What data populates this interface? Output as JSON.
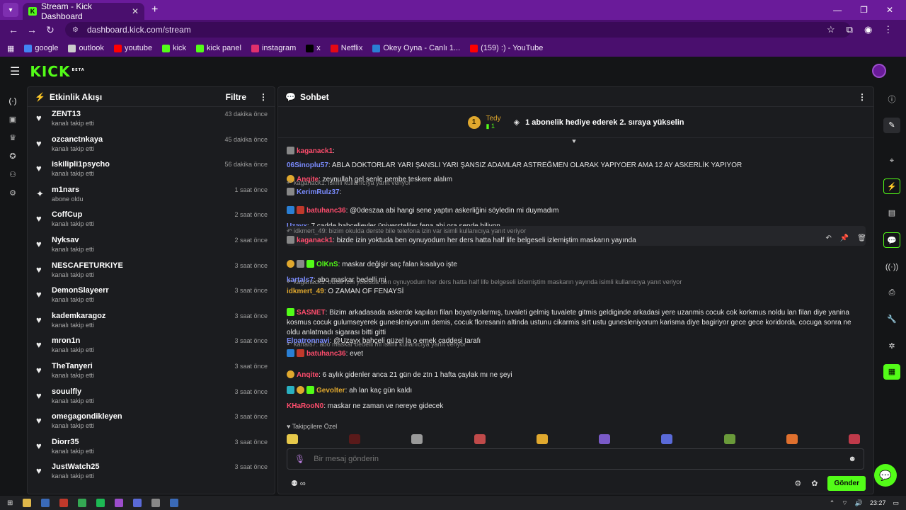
{
  "browser": {
    "tab_title": "Stream - Kick Dashboard",
    "url": "dashboard.kick.com/stream",
    "bookmarks": [
      {
        "label": "google",
        "color": "#4285f4"
      },
      {
        "label": "outlook",
        "color": "#cccccc"
      },
      {
        "label": "youtube",
        "color": "#ff0000"
      },
      {
        "label": "kick",
        "color": "#53fc18"
      },
      {
        "label": "kick panel",
        "color": "#53fc18"
      },
      {
        "label": "instagram",
        "color": "#e1306c"
      },
      {
        "label": "x",
        "color": "#000000"
      },
      {
        "label": "Netflix",
        "color": "#e50914"
      },
      {
        "label": "Okey Oyna - Canlı 1...",
        "color": "#2a7fd4"
      },
      {
        "label": "(159) :) - YouTube",
        "color": "#ff0000"
      }
    ]
  },
  "header": {
    "logo": "KICK",
    "beta": "BETA"
  },
  "activity": {
    "title": "Etkinlik Akışı",
    "filter": "Filtre",
    "items": [
      {
        "user": "ZENT13",
        "action": "kanalı takip etti",
        "time": "43 dakika önce",
        "icon": "heart-icon"
      },
      {
        "user": "ozcanctnkaya",
        "action": "kanalı takip etti",
        "time": "45 dakika önce",
        "icon": "heart-icon"
      },
      {
        "user": "iskilipli1psycho",
        "action": "kanalı takip etti",
        "time": "56 dakika önce",
        "icon": "heart-icon"
      },
      {
        "user": "m1nars",
        "action": "abone oldu",
        "time": "1 saat önce",
        "icon": "star-icon"
      },
      {
        "user": "CoffCup",
        "action": "kanalı takip etti",
        "time": "2 saat önce",
        "icon": "heart-icon"
      },
      {
        "user": "Nyksav",
        "action": "kanalı takip etti",
        "time": "2 saat önce",
        "icon": "heart-icon"
      },
      {
        "user": "NESCAFETURKIYE",
        "action": "kanalı takip etti",
        "time": "3 saat önce",
        "icon": "heart-icon"
      },
      {
        "user": "DemonSlayeerr",
        "action": "kanalı takip etti",
        "time": "3 saat önce",
        "icon": "heart-icon"
      },
      {
        "user": "kademkaragoz",
        "action": "kanalı takip etti",
        "time": "3 saat önce",
        "icon": "heart-icon"
      },
      {
        "user": "mron1n",
        "action": "kanalı takip etti",
        "time": "3 saat önce",
        "icon": "heart-icon"
      },
      {
        "user": "TheTanyeri",
        "action": "kanalı takip etti",
        "time": "3 saat önce",
        "icon": "heart-icon"
      },
      {
        "user": "souulfly",
        "action": "kanalı takip etti",
        "time": "3 saat önce",
        "icon": "heart-icon"
      },
      {
        "user": "omegagondikleyen",
        "action": "kanalı takip etti",
        "time": "3 saat önce",
        "icon": "heart-icon"
      },
      {
        "user": "Diorr35",
        "action": "kanalı takip etti",
        "time": "3 saat önce",
        "icon": "heart-icon"
      },
      {
        "user": "JustWatch25",
        "action": "kanalı takip etti",
        "time": "3 saat önce",
        "icon": "heart-icon"
      }
    ]
  },
  "chat": {
    "title": "Sohbet",
    "gift": {
      "rank": "1",
      "name": "Tedy",
      "count": "1",
      "message": "1 abonelik hediye ederek 2. sıraya yükselin"
    },
    "messages": [
      {
        "user": "kaganack1",
        "color": "#ff4d6d",
        "text": "",
        "reply": "",
        "hl": false,
        "badges": [
          "#888888"
        ]
      },
      {
        "user": "06Sinoplu57",
        "color": "#7b8cff",
        "text": "ABLA DOKTORLAR YARI ŞANSLI YARI ŞANSIZ ADAMLAR ASTREĞMEN OLARAK YAPIYOER AMA 12 AY ASKERLİK YAPIYOR",
        "reply": "",
        "hl": false,
        "badges": []
      },
      {
        "user": "Anqite",
        "color": "#ff4d6d",
        "text": "zeynullah gel senle pembe teskere alalım",
        "reply": "",
        "hl": false,
        "badges": [
          "#e0a82e"
        ]
      },
      {
        "user": "KerimRulz37",
        "color": "#7b8cff",
        "text": "",
        "reply": "kaganack1:  isimli kullanıcıya yanıt veriyor",
        "hl": false,
        "badges": [
          "#888888"
        ]
      },
      {
        "user": "batuhanc36",
        "color": "#ff4d6d",
        "text": "@0deszaa abi hangi sene yaptın askerliğini söyledin mi duymadım",
        "reply": "",
        "hl": false,
        "badges": [
          "#2a7fd4",
          "#c0392b"
        ]
      },
      {
        "user": "Uzayx",
        "color": "#7b8cff",
        "text": "7 cadde bahçelievler üniversteliler fena abi ora sende biliyon",
        "reply": "",
        "hl": false,
        "badges": []
      },
      {
        "user": "kaganack1",
        "color": "#ff4d6d",
        "text": "bizde izin yoktuda ben oynuyodum her ders hatta half life belgeseli izlemiştim maskarın yayında",
        "reply": "idkmert_49: bizim okulda derste bile telefona izin var isimli kullanıcıya yanıt veriyor",
        "hl": true,
        "badges": [
          "#888888"
        ]
      },
      {
        "user": "OlKnS",
        "color": "#53fc18",
        "text": "maskar değişir saç falan kısalıyo işte",
        "reply": "",
        "hl": false,
        "badges": [
          "#e0a82e",
          "#888888",
          "#53fc18"
        ]
      },
      {
        "user": "kartals7",
        "color": "#7b8cff",
        "text": "abo maskar bedelli mi",
        "reply": "",
        "hl": false,
        "badges": []
      },
      {
        "user": "idkmert_49",
        "color": "#e0a82e",
        "text": "O ZAMAN OF FENAYSİ",
        "reply": "kaganack1: bizde izin yoktuda ben oynuyodum her ders hatta half life belgeseli izlemiştim maskarın yayında isimli kullanıcıya yanıt veriyor",
        "hl": false,
        "badges": []
      },
      {
        "user": "SASNET",
        "color": "#ff4d6d",
        "text": "Bizim arkadasada askerde kapıları filan boyatıyolarmış, tuvaleti gelmiş tuvalete gitmis geldiginde arkadasi yere uzanmis cocuk cok korkmus noldu lan filan diye yanina kosmus cocuk gulumseyerek gunesleniyorum demis, cocuk floresanin altinda ustunu cikarmis sirt ustu gunesleniyorum karisma diye bagiriyor gece gece koridorda, cocuga sonra ne oldu anlatmadı sigarası bitti gitti",
        "reply": "",
        "hl": false,
        "badges": [
          "#53fc18"
        ]
      },
      {
        "user": "Elpatronnavi",
        "color": "#7b8cff",
        "text": "@Uzayx bahçeli güzel la o emek caddesi tarafı",
        "reply": "",
        "hl": false,
        "badges": []
      },
      {
        "user": "batuhanc36",
        "color": "#ff4d6d",
        "text": "evet",
        "reply": "kartals7: abo maskar bedelli mi isimli kullanıcıya yanıt veriyor",
        "hl": false,
        "badges": [
          "#2a7fd4",
          "#c0392b"
        ]
      },
      {
        "user": "Anqite",
        "color": "#ff4d6d",
        "text": "6 aylık gidenler anca 21 gün de ztn 1 hafta çaylak mı ne şeyi",
        "reply": "",
        "hl": false,
        "badges": [
          "#e0a82e"
        ]
      },
      {
        "user": "Gevolter",
        "color": "#e0a82e",
        "text": "ah lan kaç gün kaldı",
        "reply": "",
        "hl": false,
        "badges": [
          "#2ab0c0",
          "#e0a82e",
          "#53fc18"
        ]
      },
      {
        "user": "KHaRooN0",
        "color": "#ff4d6d",
        "text": "maskar ne zaman ve nereye gidecek",
        "reply": "",
        "hl": false,
        "badges": []
      }
    ],
    "followers_only": "♥ Takipçilere Özel",
    "input_placeholder": "Bir mesaj gönderin",
    "send": "Gönder"
  },
  "taskbar": {
    "time": "23:27"
  }
}
